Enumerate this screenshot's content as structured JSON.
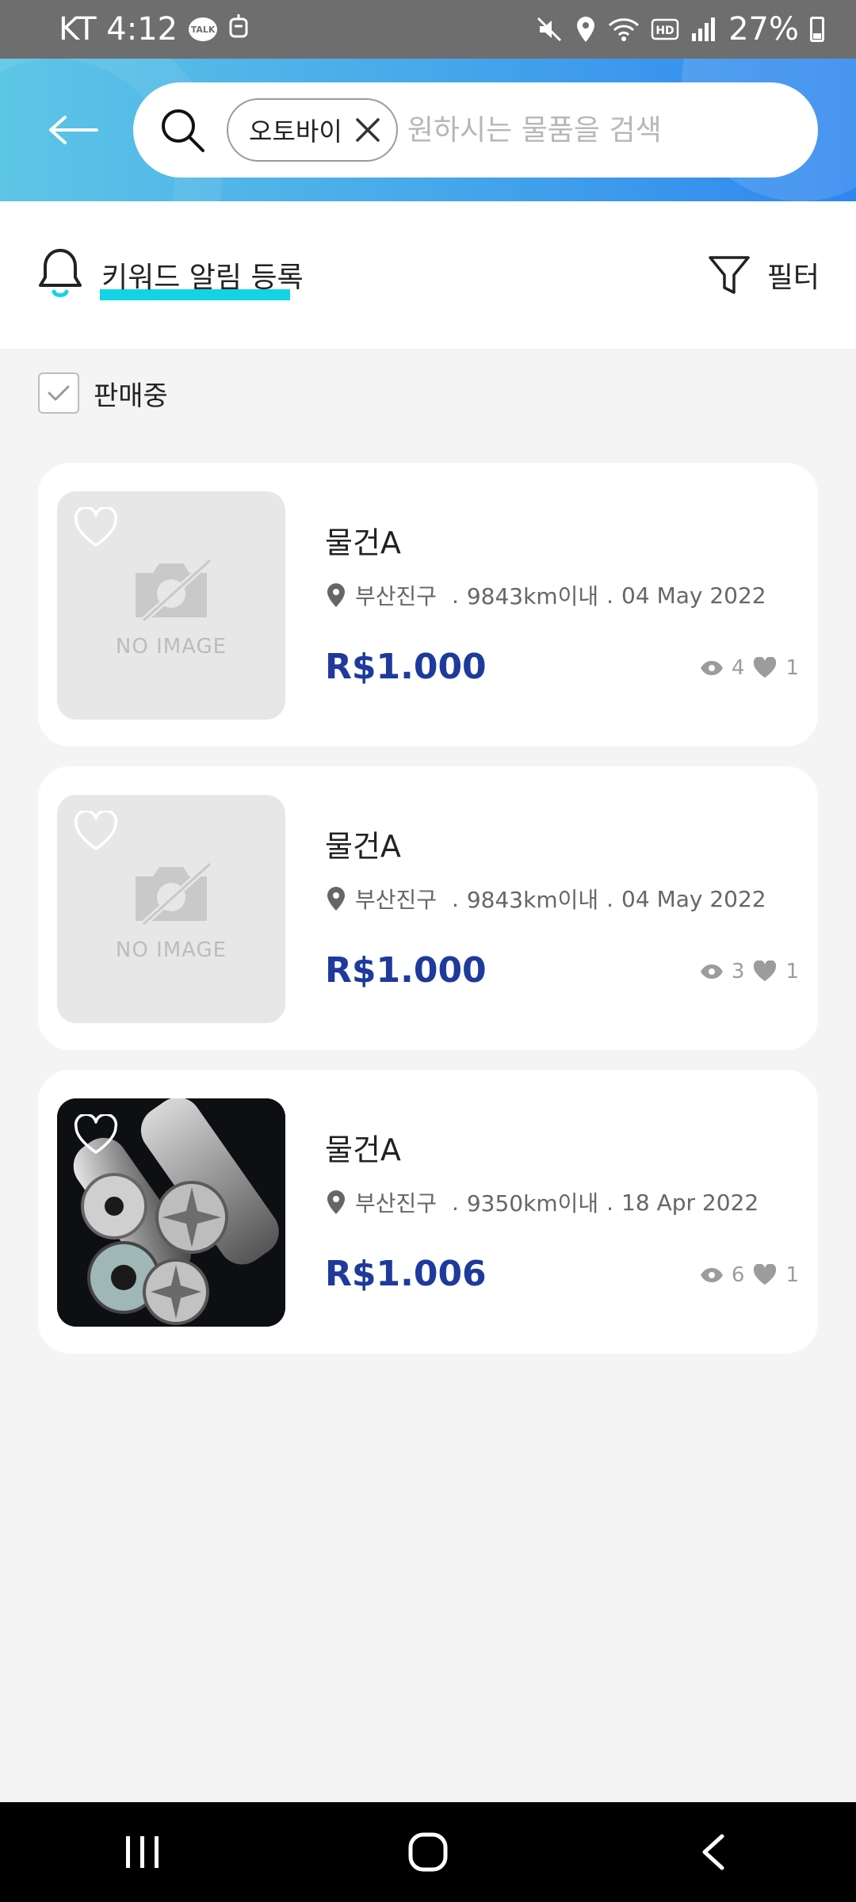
{
  "status": {
    "carrier_time": "KT 4:12",
    "talk_badge": "TALK",
    "battery": "27%"
  },
  "search": {
    "chip_label": "오토바이",
    "placeholder": "원하시는 물품을 검색"
  },
  "keyword_alert": {
    "label": "키워드 알림 등록"
  },
  "filter": {
    "label": "필터"
  },
  "selling_filter": {
    "label": "판매중",
    "checked": true
  },
  "listings": [
    {
      "title": "물건A",
      "location": "부산진구",
      "distance": "9843km이내",
      "date": "04 May 2022",
      "price": "R$1.000",
      "views": "4",
      "likes": "1",
      "image": "no-image",
      "no_image_text": "NO IMAGE"
    },
    {
      "title": "물건A",
      "location": "부산진구",
      "distance": "9843km이내",
      "date": "04 May 2022",
      "price": "R$1.000",
      "views": "3",
      "likes": "1",
      "image": "no-image",
      "no_image_text": "NO IMAGE"
    },
    {
      "title": "물건A",
      "location": "부산진구",
      "distance": "9350km이내",
      "date": "18 Apr 2022",
      "price": "R$1.006",
      "views": "6",
      "likes": "1",
      "image": "photo"
    }
  ],
  "colors": {
    "accent": "#13d3e6",
    "price": "#1d3a9c",
    "header_gradient_start": "#5dc6e6",
    "header_gradient_end": "#2f86ef"
  }
}
